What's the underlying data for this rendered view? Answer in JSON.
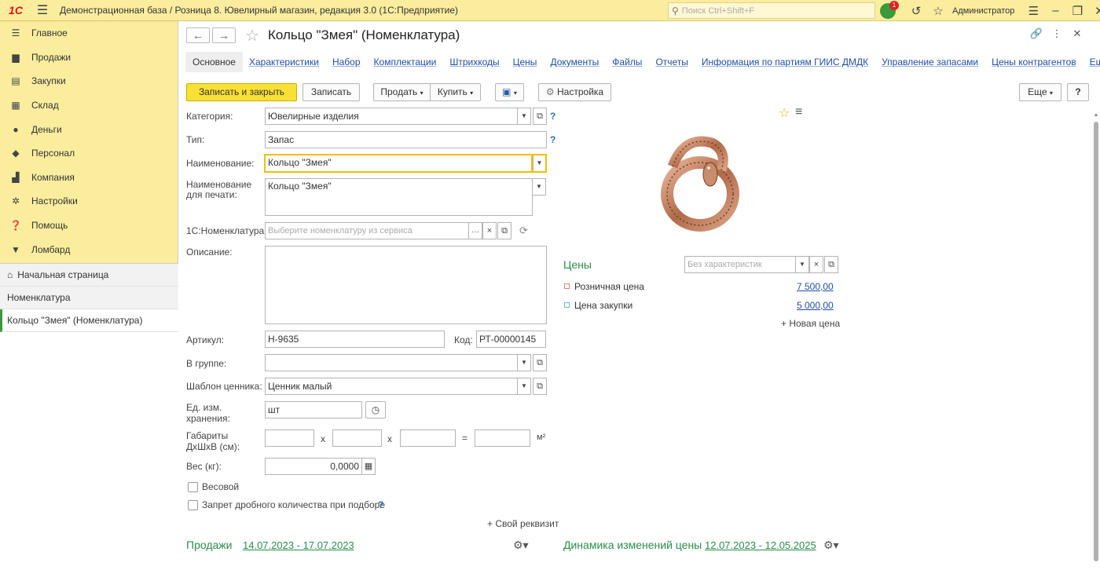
{
  "topbar": {
    "logo": "1С",
    "title": "Демонстрационная база / Розница 8. Ювелирный магазин, редакция 3.0  (1С:Предприятие)",
    "search_placeholder": "Поиск Ctrl+Shift+F",
    "notifications_count": "1",
    "user": "Администратор"
  },
  "sidebar": {
    "items": [
      {
        "label": "Главное",
        "icon": "menu-lines-icon"
      },
      {
        "label": "Продажи",
        "icon": "cart-icon"
      },
      {
        "label": "Закупки",
        "icon": "purchase-icon"
      },
      {
        "label": "Склад",
        "icon": "warehouse-icon"
      },
      {
        "label": "Деньги",
        "icon": "money-icon"
      },
      {
        "label": "Персонал",
        "icon": "person-icon"
      },
      {
        "label": "Компания",
        "icon": "company-icon"
      },
      {
        "label": "Настройки",
        "icon": "gear-icon"
      },
      {
        "label": "Помощь",
        "icon": "help-icon"
      },
      {
        "label": "Ломбард",
        "icon": "pawnshop-icon"
      }
    ],
    "open_windows": {
      "home": "Начальная страница",
      "nomenclature": "Номенклатура",
      "current": "Кольцо \"Змея\" (Номенклатура)"
    }
  },
  "form": {
    "title": "Кольцо \"Змея\" (Номенклатура)",
    "tabs": [
      "Основное",
      "Характеристики",
      "Набор",
      "Комплектации",
      "Штрихкоды",
      "Цены",
      "Документы",
      "Файлы",
      "Отчеты",
      "Информация по партиям ГИИС ДМДК",
      "Управление запасами",
      "Цены контрагентов",
      "Еще..."
    ],
    "toolbar": {
      "save_close": "Записать и закрыть",
      "save": "Записать",
      "sell": "Продать",
      "buy": "Купить",
      "settings": "Настройка",
      "more": "Еще",
      "help": "?"
    },
    "fields": {
      "category_label": "Категория:",
      "category_value": "Ювелирные изделия",
      "type_label": "Тип:",
      "type_value": "Запас",
      "name_label": "Наименование:",
      "name_value": "Кольцо \"Змея\"",
      "print_name_label_1": "Наименование",
      "print_name_label_2": "для печати:",
      "print_name_value": "Кольцо \"Змея\"",
      "nom1c_label": "1С:Номенклатура:",
      "nom1c_placeholder": "Выберите номенклатуру из сервиса",
      "description_label": "Описание:",
      "article_label": "Артикул:",
      "article_value": "Н-9635",
      "code_label": "Код:",
      "code_value": "РТ-00000145",
      "group_label": "В группе:",
      "group_value": "",
      "price_tag_label": "Шаблон ценника:",
      "price_tag_value": "Ценник малый",
      "unit_label_1": "Ед. изм.",
      "unit_label_2": "хранения:",
      "unit_value": "шт",
      "dims_label_1": "Габариты",
      "dims_label_2": "ДхШхВ (см):",
      "dims_x": "x",
      "dims_eq": "=",
      "dims_unit": "м²",
      "weight_label": "Вес (кг):",
      "weight_value": "0,0000",
      "weighted_label": "Весовой",
      "fraction_ban_label": "Запрет дробного количества при подборе",
      "own_attr": "+ Свой реквизит"
    },
    "prices": {
      "title": "Цены",
      "char_placeholder": "Без характеристик",
      "retail_label": "Розничная цена",
      "retail_value": "7 500,00",
      "retail_color": "#e08080",
      "purchase_label": "Цена закупки",
      "purchase_value": "5 000,00",
      "purchase_color": "#70b0e0",
      "new_price": "+ Новая цена"
    },
    "sales": {
      "title": "Продажи",
      "period": "14.07.2023 - 17.07.2023"
    },
    "price_dynamics": {
      "title": "Динамика изменений цены",
      "period": "12.07.2023 - 12.05.2025"
    }
  }
}
